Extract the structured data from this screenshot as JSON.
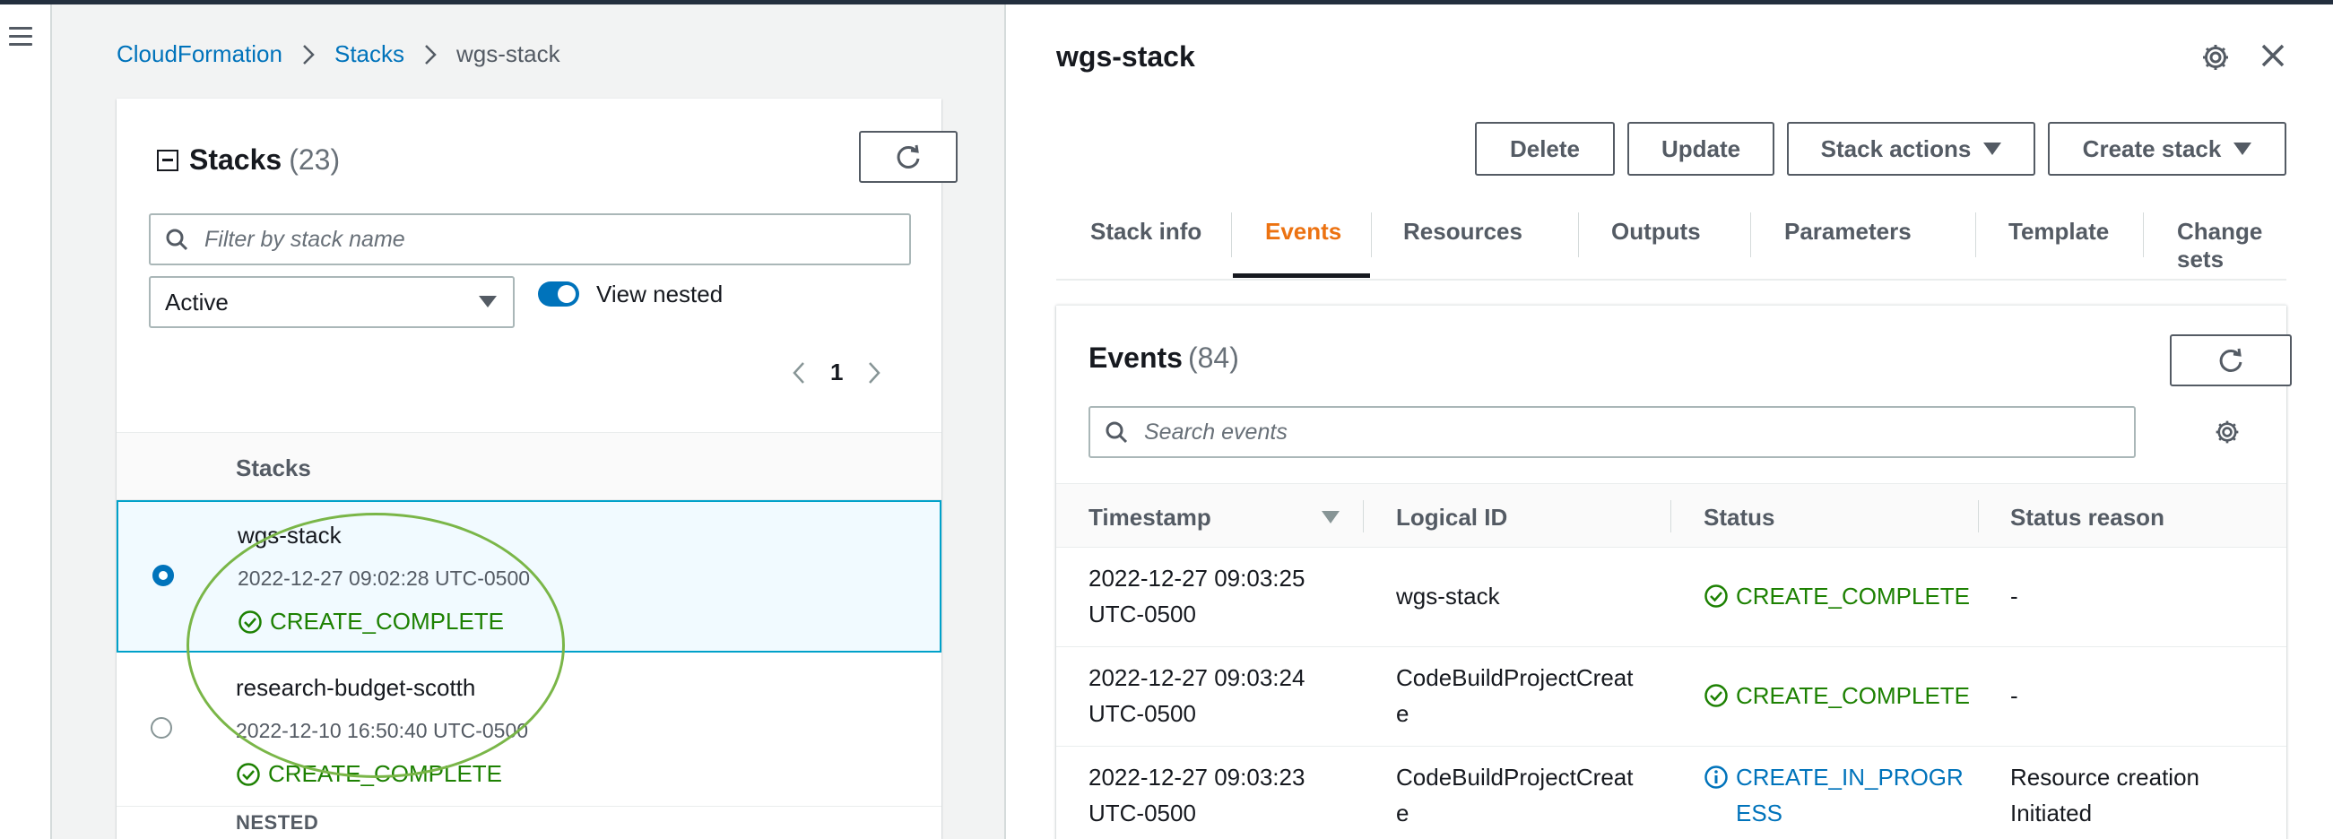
{
  "breadcrumb": [
    "CloudFormation",
    "Stacks",
    "wgs-stack"
  ],
  "stacks_panel": {
    "title": "Stacks",
    "count": "(23)",
    "filter_placeholder": "Filter by stack name",
    "status_filter": "Active",
    "view_nested_label": "View nested",
    "page": "1",
    "column_header": "Stacks",
    "rows": [
      {
        "name": "wgs-stack",
        "date": "2022-12-27 09:02:28 UTC-0500",
        "status": "CREATE_COMPLETE"
      },
      {
        "name": "research-budget-scotth",
        "date": "2022-12-10 16:50:40 UTC-0500",
        "status": "CREATE_COMPLETE"
      }
    ],
    "nested_label": "NESTED"
  },
  "detail": {
    "title": "wgs-stack",
    "buttons": {
      "delete": "Delete",
      "update": "Update",
      "stack_actions": "Stack actions",
      "create_stack": "Create stack"
    },
    "tabs": [
      "Stack info",
      "Events",
      "Resources",
      "Outputs",
      "Parameters",
      "Template",
      "Change sets"
    ],
    "active_tab": "Events"
  },
  "events": {
    "title": "Events",
    "count": "(84)",
    "search_placeholder": "Search events",
    "columns": [
      "Timestamp",
      "Logical ID",
      "Status",
      "Status reason"
    ],
    "rows": [
      {
        "timestamp_1": "2022-12-27 09:03:25",
        "timestamp_2": "UTC-0500",
        "logical_1": "wgs-stack",
        "logical_2": "",
        "status_1": "CREATE_COMPLETE",
        "status_2": "",
        "reason_1": "-",
        "reason_2": ""
      },
      {
        "timestamp_1": "2022-12-27 09:03:24",
        "timestamp_2": "UTC-0500",
        "logical_1": "CodeBuildProjectCreat",
        "logical_2": "e",
        "status_1": "CREATE_COMPLETE",
        "status_2": "",
        "reason_1": "-",
        "reason_2": ""
      },
      {
        "timestamp_1": "2022-12-27 09:03:23",
        "timestamp_2": "UTC-0500",
        "logical_1": "CodeBuildProjectCreat",
        "logical_2": "e",
        "status_1": "CREATE_IN_PROGR",
        "status_2": "ESS",
        "reason_1": "Resource creation",
        "reason_2": "Initiated"
      }
    ]
  },
  "colors": {
    "link": "#0073bb",
    "success": "#1d8102",
    "active_tab": "#ec7211",
    "highlight_oval": "#7ab648"
  }
}
